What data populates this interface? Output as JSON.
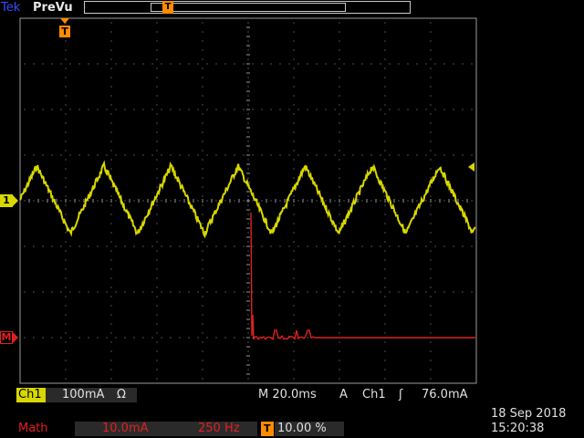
{
  "header": {
    "brand": "Tek",
    "mode": "PreVu"
  },
  "markers": {
    "trigger_position": "T",
    "channel1": "1",
    "math": "M"
  },
  "colors": {
    "ch1": "#d8d800",
    "math": "#e02020",
    "grid": "#9a9a9a",
    "trigger": "#ff8c00"
  },
  "waveform": {
    "ch1_shape": "triangle",
    "ch1_periods_on_screen": 6.8,
    "math_shape": "step-then-flat"
  },
  "status": {
    "ch1_label": "Ch1",
    "ch1_scale": "100mA",
    "ch1_unit_symbol": "Ω",
    "timebase": "M 20.0ms",
    "acq_mode": "A",
    "trigger_source": "Ch1",
    "trigger_slope_icon": "rising-edge-icon",
    "trigger_level": "76.0mA",
    "math_label": "Math",
    "math_scale": "10.0mA",
    "math_freq": "250 Hz",
    "trigger_pos_marker": "T",
    "trigger_pos_percent": "10.00 %",
    "date": "18 Sep  2018",
    "time": "15:20:38"
  }
}
